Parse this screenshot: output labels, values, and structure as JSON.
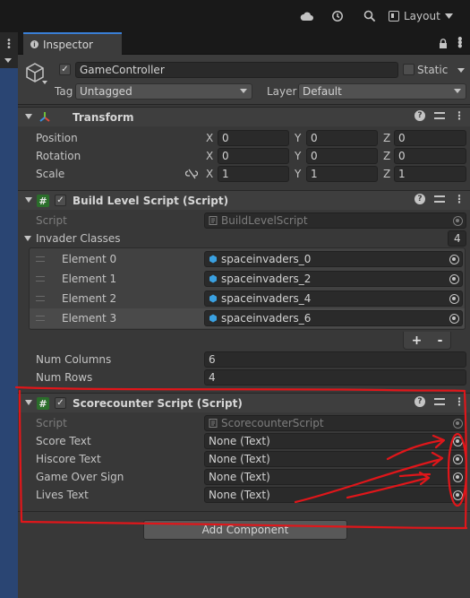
{
  "toolbar": {
    "cloud_icon": "cloud-icon",
    "history_icon": "history-icon",
    "search_icon": "search-icon",
    "layout_label": "Layout"
  },
  "tab": {
    "label": "Inspector"
  },
  "gameobject": {
    "name": "GameController",
    "active": true,
    "static_label": "Static",
    "tag_label": "Tag",
    "tag_value": "Untagged",
    "layer_label": "Layer",
    "layer_value": "Default"
  },
  "transform": {
    "title": "Transform",
    "position_label": "Position",
    "rotation_label": "Rotation",
    "scale_label": "Scale",
    "axis_x": "X",
    "axis_y": "Y",
    "axis_z": "Z",
    "position": {
      "x": "0",
      "y": "0",
      "z": "0"
    },
    "rotation": {
      "x": "0",
      "y": "0",
      "z": "0"
    },
    "scale": {
      "x": "1",
      "y": "1",
      "z": "1"
    }
  },
  "build_level": {
    "title": "Build Level Script (Script)",
    "script_label": "Script",
    "script_value": "BuildLevelScript",
    "invader_label": "Invader Classes",
    "invader_count": "4",
    "elements": [
      {
        "label": "Element 0",
        "value": "spaceinvaders_0"
      },
      {
        "label": "Element 1",
        "value": "spaceinvaders_2"
      },
      {
        "label": "Element 2",
        "value": "spaceinvaders_4"
      },
      {
        "label": "Element 3",
        "value": "spaceinvaders_6"
      }
    ],
    "plus": "+",
    "minus": "-",
    "num_columns_label": "Num Columns",
    "num_columns_value": "6",
    "num_rows_label": "Num Rows",
    "num_rows_value": "4"
  },
  "scorecounter": {
    "title": "Scorecounter Script (Script)",
    "script_label": "Script",
    "script_value": "ScorecounterScript",
    "fields": [
      {
        "label": "Score Text",
        "value": "None (Text)"
      },
      {
        "label": "Hiscore Text",
        "value": "None (Text)"
      },
      {
        "label": "Game Over Sign",
        "value": "None (Text)"
      },
      {
        "label": "Lives Text",
        "value": "None (Text)"
      }
    ]
  },
  "add_component_label": "Add Component",
  "annotation_color": "#e0161a"
}
